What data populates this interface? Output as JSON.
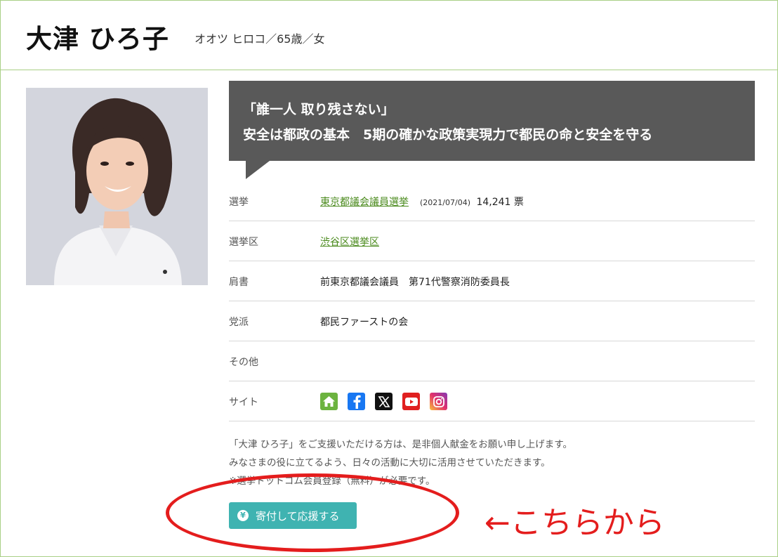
{
  "candidate": {
    "name": "大津 ひろ子",
    "kana_age_gender": "オオツ ヒロコ／65歳／女"
  },
  "slogan": {
    "line1": "「誰一人 取り残さない」",
    "line2": "安全は都政の基本　5期の確かな政策実現力で都民の命と安全を守る"
  },
  "info": {
    "election_label": "選挙",
    "election_link": "東京都議会議員選挙",
    "election_date": "(2021/07/04)",
    "election_votes": "14,241 票",
    "district_label": "選挙区",
    "district_link": "渋谷区選挙区",
    "title_label": "肩書",
    "title_value": "前東京都議会議員　第71代警察消防委員長",
    "party_label": "党派",
    "party_value": "都民ファーストの会",
    "other_label": "その他",
    "other_value": "",
    "site_label": "サイト"
  },
  "site_icons": [
    "home-icon",
    "facebook-icon",
    "x-icon",
    "youtube-icon",
    "instagram-icon"
  ],
  "note": {
    "line1": "「大津 ひろ子」をご支援いただける方は、是非個人献金をお願い申し上げます。",
    "line2": "みなさまの役に立てるよう、日々の活動に大切に活用させていただきます。",
    "line3": "※選挙ドットコム会員登録（無料）が必要です。"
  },
  "donate": {
    "icon": "¥",
    "label": "寄付して応援する"
  },
  "annotation": {
    "text": "←こちらから"
  },
  "colors": {
    "border_green": "#a9cf86",
    "slogan_bg": "#595959",
    "link_green": "#4a8a1c",
    "donate_teal": "#3fb3b1",
    "annotation_red": "#e41d1d"
  }
}
